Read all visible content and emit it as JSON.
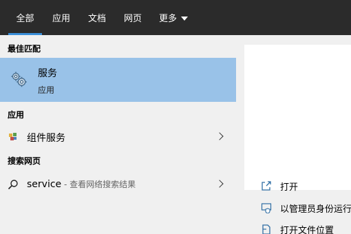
{
  "tabs": [
    {
      "label": "全部",
      "active": true
    },
    {
      "label": "应用",
      "active": false
    },
    {
      "label": "文档",
      "active": false
    },
    {
      "label": "网页",
      "active": false
    },
    {
      "label": "更多",
      "active": false
    }
  ],
  "colors": {
    "accent": "#3a8fd8",
    "selected_bg": "#99c2e8",
    "tabbar_bg": "#2b2b2b"
  },
  "sections": {
    "best_match": "最佳匹配",
    "apps": "应用",
    "web": "搜索网页"
  },
  "best_match": {
    "title": "服务",
    "subtitle": "应用",
    "icon": "services-gear-icon"
  },
  "apps": [
    {
      "label": "组件服务",
      "icon": "component-services-icon"
    }
  ],
  "web": {
    "query": "service",
    "hint": " - 查看网络搜索结果",
    "icon": "search-icon"
  },
  "actions": [
    {
      "label": "打开",
      "icon": "open-icon"
    },
    {
      "label": "以管理员身份运行",
      "icon": "run-as-admin-icon"
    },
    {
      "label": "打开文件位置",
      "icon": "file-location-icon"
    }
  ]
}
